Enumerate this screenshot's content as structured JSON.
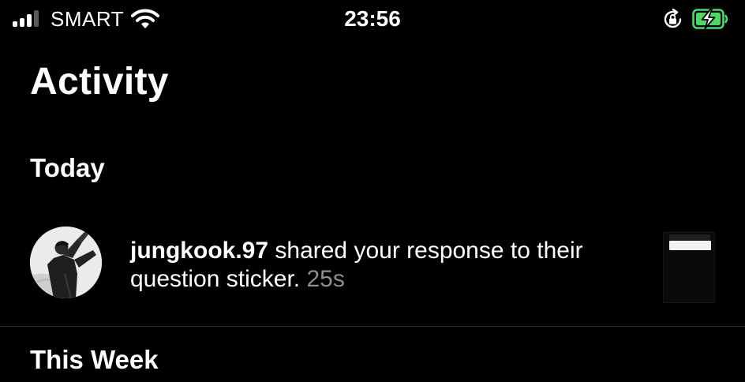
{
  "status_bar": {
    "carrier": "SMART",
    "time": "23:56",
    "icons": [
      "cellular-signal-icon",
      "wifi-icon",
      "orientation-lock-icon",
      "battery-charging-icon"
    ]
  },
  "header": {
    "title": "Activity"
  },
  "sections": [
    {
      "title": "Today",
      "items": [
        {
          "username": "jungkook.97",
          "message": " shared your response to their question sticker. ",
          "time": "25s"
        }
      ]
    },
    {
      "title": "This Week",
      "items": []
    }
  ],
  "colors": {
    "background": "#000000",
    "text": "#ffffff",
    "muted": "#8e8e8e",
    "battery": "#4cd964"
  }
}
